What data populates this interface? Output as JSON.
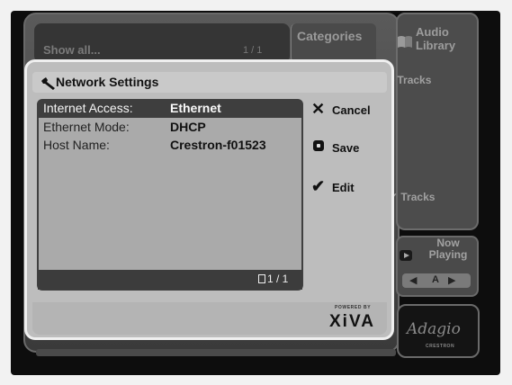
{
  "background": {
    "show_all": "Show all...",
    "page_indicator": "1 / 1",
    "categories": "Categories",
    "audio_library": "Audio Library",
    "tracks_top": "Tracks",
    "tracks_bottom": "Tracks",
    "now_playing": "Now Playing",
    "nav_letter": "A",
    "adagio": "Adagio",
    "crestron": "CRESTRON"
  },
  "dialog": {
    "title": "Network Settings",
    "rows": [
      {
        "label": "Internet Access:",
        "value": "Ethernet",
        "selected": true
      },
      {
        "label": "Ethernet Mode:",
        "value": "DHCP",
        "selected": false
      },
      {
        "label": "Host Name:",
        "value": "Crestron-f01523",
        "selected": false
      }
    ],
    "page": "1 / 1",
    "actions": {
      "cancel": "Cancel",
      "save": "Save",
      "edit": "Edit"
    },
    "powered_by": "POWERED BY",
    "brand": "XiVA"
  },
  "icons": {
    "title": "wrench-icon",
    "cancel": "x-icon",
    "save": "save-icon",
    "edit": "checkmark-icon",
    "page": "page-icon",
    "audio": "book-icon",
    "now_playing": "play-icon"
  }
}
